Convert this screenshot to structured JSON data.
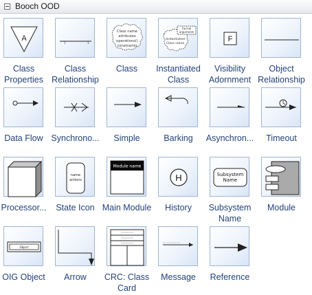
{
  "panel": {
    "title": "Booch OOD"
  },
  "items": [
    {
      "name": "class-properties",
      "label": "Class Properties",
      "icon": "class-properties-icon"
    },
    {
      "name": "class-relationship",
      "label": "Class Relationship",
      "icon": "class-relationship-icon"
    },
    {
      "name": "class",
      "label": "Class",
      "icon": "class-cloud-icon"
    },
    {
      "name": "instantiated-class",
      "label": "Instantiated Class",
      "icon": "instantiated-class-icon"
    },
    {
      "name": "visibility-adornment",
      "label": "Visibility Adornment",
      "icon": "visibility-adornment-icon"
    },
    {
      "name": "object-relationship",
      "label": "Object Relationship",
      "icon": "object-relationship-icon"
    },
    {
      "name": "data-flow",
      "label": "Data Flow",
      "icon": "data-flow-icon"
    },
    {
      "name": "synchronous",
      "label": "Synchrono...",
      "icon": "synchronous-icon"
    },
    {
      "name": "simple",
      "label": "Simple",
      "icon": "simple-arrow-icon"
    },
    {
      "name": "barking",
      "label": "Barking",
      "icon": "barking-icon"
    },
    {
      "name": "asynchronous",
      "label": "Asynchron...",
      "icon": "asynchronous-icon"
    },
    {
      "name": "timeout",
      "label": "Timeout",
      "icon": "timeout-icon"
    },
    {
      "name": "processor",
      "label": "Processor...",
      "icon": "processor-cube-icon"
    },
    {
      "name": "state-icon",
      "label": "State Icon",
      "icon": "state-icon"
    },
    {
      "name": "main-module",
      "label": "Main Module",
      "icon": "main-module-icon"
    },
    {
      "name": "history",
      "label": "History",
      "icon": "history-icon"
    },
    {
      "name": "subsystem-name",
      "label": "Subsystem Name",
      "icon": "subsystem-icon"
    },
    {
      "name": "module",
      "label": "Module",
      "icon": "module-icon"
    },
    {
      "name": "oig-object",
      "label": "OIG Object",
      "icon": "oig-object-icon"
    },
    {
      "name": "arrow",
      "label": "Arrow",
      "icon": "arrow-icon"
    },
    {
      "name": "crc-class-card",
      "label": "CRC: Class Card",
      "icon": "crc-card-icon"
    },
    {
      "name": "message",
      "label": "Message",
      "icon": "message-icon"
    },
    {
      "name": "reference",
      "label": "Reference",
      "icon": "reference-icon"
    }
  ],
  "glyphs": {
    "class_properties_letter": "A",
    "visibility_letter": "F",
    "history_letter": "H",
    "class_cloud_lines": [
      "Class name",
      "attributes",
      "operations()",
      "constraints"
    ],
    "instantiated_top_lines": [
      "Formal",
      "arguments"
    ],
    "instantiated_cloud_lines": [
      "Instantiated",
      "Class name"
    ],
    "state_lines": [
      "name",
      "actions"
    ],
    "main_module_text": "Module name",
    "subsystem_lines": [
      "Subsystem",
      "Name"
    ],
    "oig_text": "Object"
  }
}
